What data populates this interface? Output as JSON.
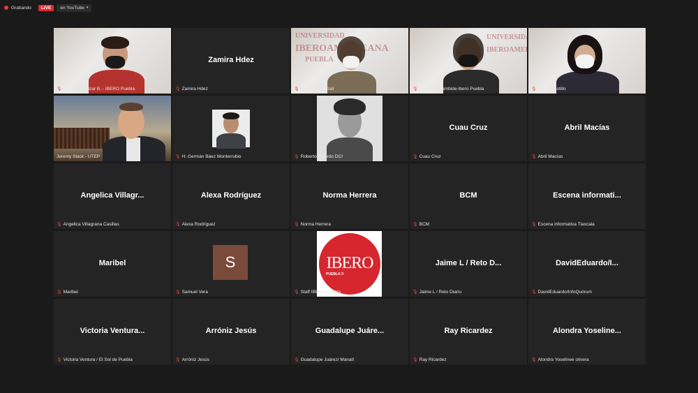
{
  "topbar": {
    "recording_label": "Grabando",
    "live_label": "LIVE",
    "youtube_label": "en YouTube",
    "caret": "▾"
  },
  "colors": {
    "active_speaker_border": "#a6d13a",
    "live_red": "#e02a2a",
    "muted_mic": "#e54848",
    "tile_bg": "#242424"
  },
  "tiles": [
    {
      "center": "",
      "label": "Guillermo Yrizar B. - IBERO Puebla"
    },
    {
      "center": "Zamira Hdez",
      "label": "Zamira Hdez"
    },
    {
      "center": "",
      "label": "Elena Ayala Galí"
    },
    {
      "center": "",
      "label": "Rosario Arrambide-Ibero Puebla"
    },
    {
      "center": "",
      "label": "Nadia Castillo"
    },
    {
      "center": "",
      "label": "Jeremy Slack - UTEP"
    },
    {
      "center": "",
      "label": "H. Germán Báez Monterrubio"
    },
    {
      "center": "",
      "label": "Roberto Ricardo DCI"
    },
    {
      "center": "Cuau Cruz",
      "label": "Cuau Cruz"
    },
    {
      "center": "Abril Macías",
      "label": "Abril Macías"
    },
    {
      "center": "Angelica  Villagr...",
      "label": "Angelica Villagrana Casillas"
    },
    {
      "center": "Alexa Rodríguez",
      "label": "Alexa Rodríguez"
    },
    {
      "center": "Norma Herrera",
      "label": "Norma Herrera"
    },
    {
      "center": "BCM",
      "label": "BCM"
    },
    {
      "center": "Escena  informati...",
      "label": "Escena informativa Tlaxcala"
    },
    {
      "center": "Maribel",
      "label": "Maribel"
    },
    {
      "center": "",
      "label": "Samuel Vera",
      "avatar_letter": "S"
    },
    {
      "center": "",
      "label": "Staff IBERO Puebla",
      "logo_text": "IBERO",
      "logo_sub": "PUEBLA ®"
    },
    {
      "center": "Jaime L / Reto D...",
      "label": "Jaime L / Reto Diario"
    },
    {
      "center": "DavidEduardo/I...",
      "label": "DavidEduardo/InfoQuórum"
    },
    {
      "center": "Victoria  Ventura...",
      "label": "Victoria Ventura / El Sol de Puebla"
    },
    {
      "center": "Arróniz Jesús",
      "label": "Arróniz Jesús"
    },
    {
      "center": "Guadalupe  Juáre...",
      "label": "Guadalupe Juárez/ Manatí"
    },
    {
      "center": "Ray Ricardez",
      "label": "Ray Ricardez"
    },
    {
      "center": "Alondra  Yoseline...",
      "label": "Alondra Yoselinee olivera"
    }
  ]
}
